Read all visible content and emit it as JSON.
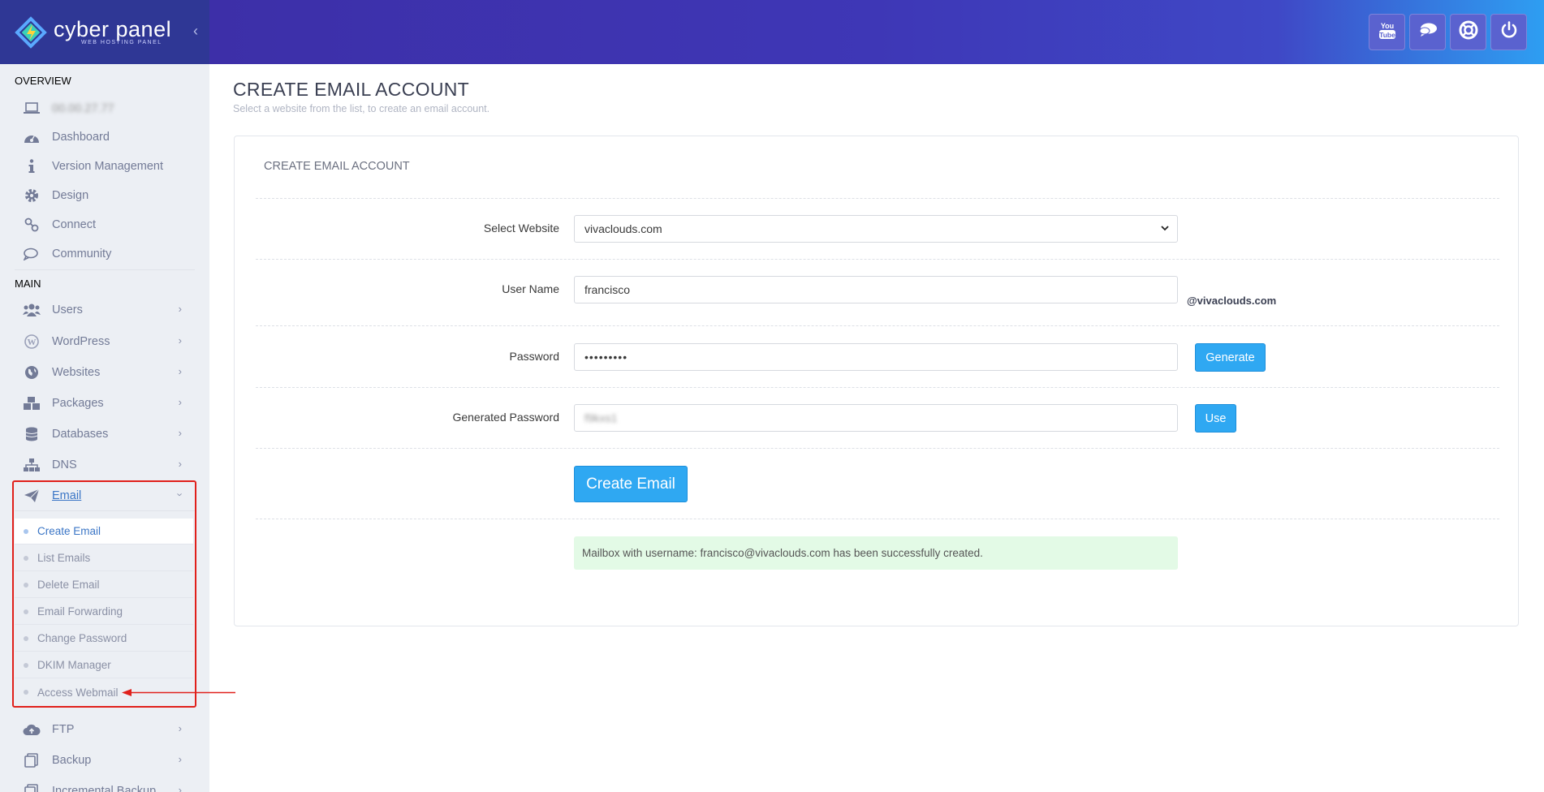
{
  "brand": {
    "name": "cyber panel",
    "tagline": "WEB HOSTING PANEL",
    "accent": "#2f3795"
  },
  "sidebar": {
    "overview_title": "OVERVIEW",
    "server_ip": "00.00.27.77",
    "overview_items": [
      {
        "label": "Dashboard",
        "icon": "dashboard-icon"
      },
      {
        "label": "Version Management",
        "icon": "info-icon"
      },
      {
        "label": "Design",
        "icon": "gear-icon"
      },
      {
        "label": "Connect",
        "icon": "link-icon"
      },
      {
        "label": "Community",
        "icon": "chat-icon"
      }
    ],
    "main_title": "MAIN",
    "main_items": [
      {
        "label": "Users",
        "icon": "users-icon"
      },
      {
        "label": "WordPress",
        "icon": "wordpress-icon"
      },
      {
        "label": "Websites",
        "icon": "globe-icon"
      },
      {
        "label": "Packages",
        "icon": "packages-icon"
      },
      {
        "label": "Databases",
        "icon": "database-icon"
      },
      {
        "label": "DNS",
        "icon": "sitemap-icon"
      }
    ],
    "email": {
      "label": "Email",
      "icon": "paper-plane-icon",
      "sub_items": [
        "Create Email",
        "List Emails",
        "Delete Email",
        "Email Forwarding",
        "Change Password",
        "DKIM Manager",
        "Access Webmail"
      ],
      "active_index": 0
    },
    "after_items": [
      {
        "label": "FTP",
        "icon": "cloud-upload-icon"
      },
      {
        "label": "Backup",
        "icon": "backup-icon"
      },
      {
        "label": "Incremental Backup",
        "icon": "backup-icon"
      }
    ]
  },
  "topbar": {
    "buttons": [
      "youtube-icon",
      "chat-icon",
      "support-icon",
      "power-icon"
    ]
  },
  "page": {
    "title": "CREATE EMAIL ACCOUNT",
    "subtitle": "Select a website from the list, to create an email account."
  },
  "form": {
    "panel_title": "CREATE EMAIL ACCOUNT",
    "select_website_label": "Select Website",
    "selected_website": "vivaclouds.com",
    "username_label": "User Name",
    "username_value": "francisco",
    "domain_suffix": "@vivaclouds.com",
    "password_label": "Password",
    "password_value": "•••••••••",
    "generate_label": "Generate",
    "generated_password_label": "Generated Password",
    "generated_password_value": "f9kxs1",
    "use_label": "Use",
    "create_button_label": "Create Email",
    "success_message": "Mailbox with username: francisco@vivaclouds.com has been successfully created."
  },
  "colors": {
    "highlight": "#e0201b",
    "button": "#2fa8f2",
    "success_bg": "#e3fae6"
  }
}
